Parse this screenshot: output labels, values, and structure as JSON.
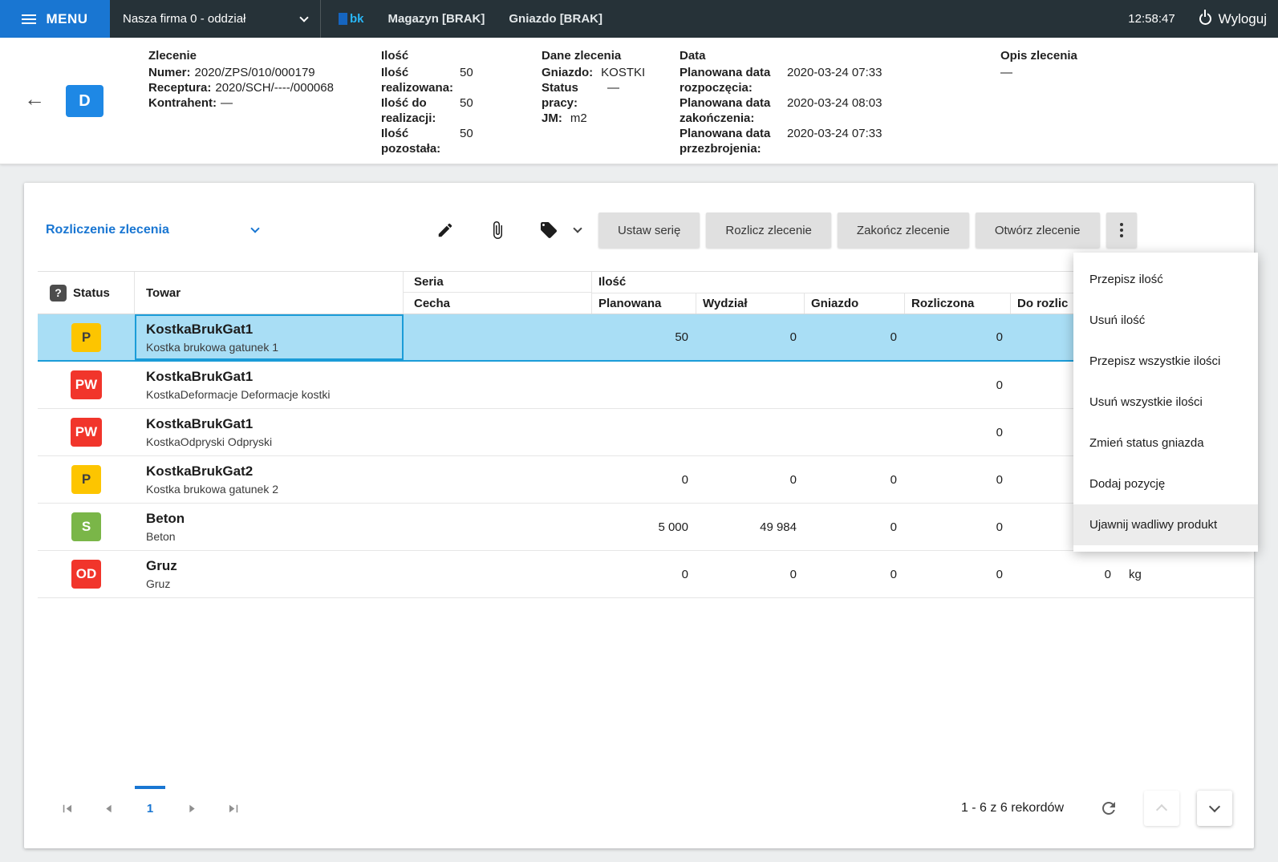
{
  "colors": {
    "accent": "#1976d2",
    "topbar": "#263238",
    "selected_row": "#a9def5",
    "selected_border": "#1b9cd8",
    "badge_yellow": "#fdc500",
    "badge_red": "#f1352b",
    "badge_green": "#7ab648"
  },
  "icons": {
    "help": "?"
  },
  "topbar": {
    "menu_label": "MENU",
    "company": "Nasza firma 0 - oddział",
    "logo": "bk",
    "magazyn": "Magazyn [BRAK]",
    "gniazdo": "Gniazdo [BRAK]",
    "time": "12:58:47",
    "logout": "Wyloguj"
  },
  "order_header": {
    "initial": "D",
    "zlecenie": {
      "title": "Zlecenie",
      "numer_label": "Numer:",
      "numer": "2020/ZPS/010/000179",
      "receptura_label": "Receptura:",
      "receptura": "2020/SCH/----/000068",
      "kontrahent_label": "Kontrahent:",
      "kontrahent": "—"
    },
    "ilosc": {
      "title": "Ilość",
      "realizowana_label": "Ilość realizowana:",
      "realizowana": "50",
      "do_realizacji_label": "Ilość do realizacji:",
      "do_realizacji": "50",
      "pozostala_label": "Ilość pozostała:",
      "pozostala": "50"
    },
    "dane": {
      "title": "Dane zlecenia",
      "gniazdo_label": "Gniazdo:",
      "gniazdo": "KOSTKI",
      "status_label": "Status pracy:",
      "status": "—",
      "jm_label": "JM:",
      "jm": "m2"
    },
    "daty": {
      "title": "Data",
      "rozpoczecia_label": "Planowana data rozpoczęcia:",
      "rozpoczecia": "2020-03-24 07:33",
      "zakonczenia_label": "Planowana data zakończenia:",
      "zakonczenia": "2020-03-24 08:03",
      "przezbrojenia_label": "Planowana data przezbrojenia:",
      "przezbrojenia": "2020-03-24 07:33"
    },
    "opis": {
      "title": "Opis zlecenia",
      "value": "—"
    }
  },
  "toolbar": {
    "view_select": "Rozliczenie zlecenia",
    "buttons": [
      "Ustaw serię",
      "Rozlicz zlecenie",
      "Zakończ zlecenie",
      "Otwórz zlecenie"
    ]
  },
  "menu": {
    "items": [
      "Przepisz ilość",
      "Usuń ilość",
      "Przepisz wszystkie ilości",
      "Usuń wszystkie ilości",
      "Zmień status gniazda",
      "Dodaj pozycję",
      "Ujawnij wadliwy produkt"
    ],
    "highlighted_index": 6
  },
  "table": {
    "col_status": "Status",
    "col_towar": "Towar",
    "col_seria": "Seria",
    "col_cecha": "Cecha",
    "col_ilosc": "Ilość",
    "col_planowana": "Planowana",
    "col_wydzial": "Wydział",
    "col_gniazdo": "Gniazdo",
    "col_rozliczona": "Rozliczona",
    "col_do_rozliczenia": "Do rozlic",
    "rows": [
      {
        "status": "P",
        "status_class": "yellow",
        "name": "KostkaBrukGat1",
        "subtitle": "Kostka brukowa gatunek 1",
        "planowana": "50",
        "wydzial": "0",
        "gniazdo": "0",
        "rozliczona": "0",
        "do_rozliczenia": "",
        "jm": "",
        "selected": true
      },
      {
        "status": "PW",
        "status_class": "red",
        "name": "KostkaBrukGat1",
        "subtitle": "KostkaDeformacje Deformacje kostki",
        "planowana": "",
        "wydzial": "",
        "gniazdo": "",
        "rozliczona": "0",
        "do_rozliczenia": "",
        "jm": "",
        "selected": false
      },
      {
        "status": "PW",
        "status_class": "red",
        "name": "KostkaBrukGat1",
        "subtitle": "KostkaOdpryski Odpryski",
        "planowana": "",
        "wydzial": "",
        "gniazdo": "",
        "rozliczona": "0",
        "do_rozliczenia": "",
        "jm": "",
        "selected": false
      },
      {
        "status": "P",
        "status_class": "yellow",
        "name": "KostkaBrukGat2",
        "subtitle": "Kostka brukowa gatunek 2",
        "planowana": "0",
        "wydzial": "0",
        "gniazdo": "0",
        "rozliczona": "0",
        "do_rozliczenia": "",
        "jm": "",
        "selected": false
      },
      {
        "status": "S",
        "status_class": "green",
        "name": "Beton",
        "subtitle": "Beton",
        "planowana": "5 000",
        "wydzial": "49 984",
        "gniazdo": "0",
        "rozliczona": "0",
        "do_rozliczenia": "",
        "jm": "",
        "selected": false
      },
      {
        "status": "OD",
        "status_class": "red",
        "name": "Gruz",
        "subtitle": "Gruz",
        "planowana": "0",
        "wydzial": "0",
        "gniazdo": "0",
        "rozliczona": "0",
        "do_rozliczenia": "0",
        "jm": "kg",
        "selected": false
      }
    ]
  },
  "pagination": {
    "page": "1",
    "records": "1 - 6 z 6 rekordów"
  }
}
